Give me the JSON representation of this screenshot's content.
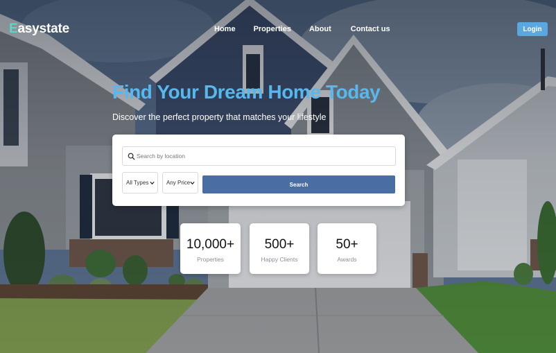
{
  "brand": {
    "first_letter": "E",
    "rest": "asystate"
  },
  "nav": {
    "items": [
      "Home",
      "Properties",
      "About",
      "Contact us"
    ],
    "login_label": "Login"
  },
  "hero": {
    "title": "Find Your Dream Home Today",
    "subtitle": "Discover the perfect property that matches your lifestyle"
  },
  "search": {
    "placeholder": "Search by location",
    "type_select": {
      "selected": "All Types"
    },
    "price_select": {
      "selected": "Any Price"
    },
    "button_label": "Search"
  },
  "stats": [
    {
      "value": "10,000+",
      "label": "Properties"
    },
    {
      "value": "500+",
      "label": "Happy Clients"
    },
    {
      "value": "50+",
      "label": "Awards"
    }
  ],
  "colors": {
    "accent": "#56b8ee",
    "brand_letter": "#5dd6c8",
    "login_button": "#5aa8df",
    "search_button": "#4a6da3"
  },
  "icons": {
    "search": "search-icon",
    "select": "chevron-down-icon"
  }
}
